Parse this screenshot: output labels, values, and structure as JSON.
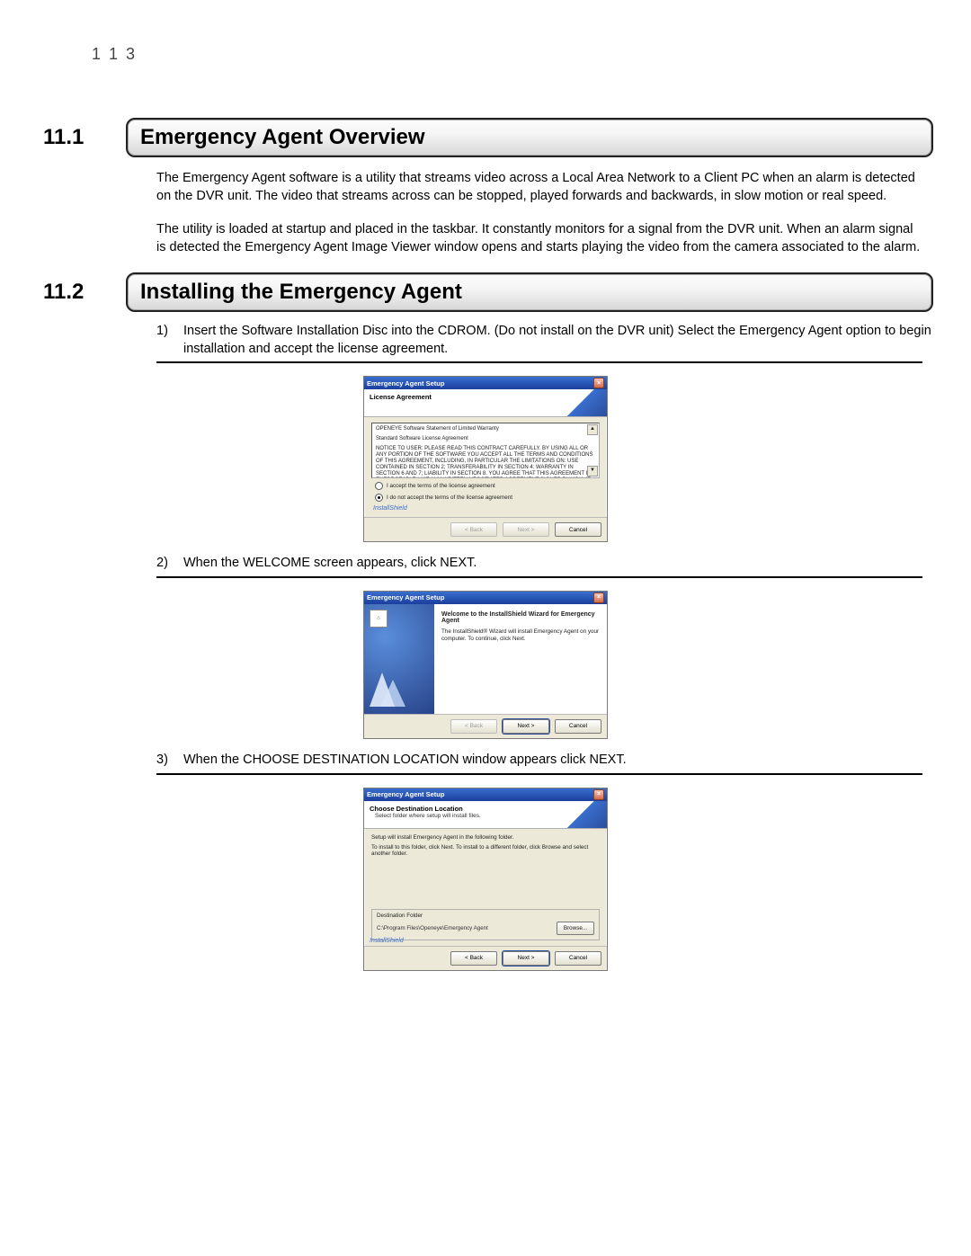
{
  "page_number": "1 1 3",
  "sections": [
    {
      "num": "11.1",
      "title": "Emergency Agent Overview"
    },
    {
      "num": "11.2",
      "title": "Installing the Emergency Agent"
    }
  ],
  "overview": {
    "p1": "The Emergency Agent software is a utility that streams video across a Local Area Network to a Client PC when an alarm is detected on the DVR unit. The video that streams across can be stopped, played forwards and backwards, in slow motion or real speed.",
    "p2": "The utility is loaded at startup and placed in the taskbar. It constantly monitors for a signal from the DVR unit. When an alarm signal is detected the Emergency Agent Image Viewer window opens and starts playing the video from the camera associated to the alarm."
  },
  "steps": [
    {
      "n": "1)",
      "t": "Insert the Software Installation Disc into the CDROM. (Do not install on the DVR unit) Select the Emergency Agent option to begin installation and accept the license agreement."
    },
    {
      "n": "2)",
      "t": "When the WELCOME screen appears, click NEXT."
    },
    {
      "n": "3)",
      "t": "When the CHOOSE DESTINATION LOCATION window appears click NEXT."
    }
  ],
  "dialog_common": {
    "title": "Emergency Agent Setup",
    "brand": "InstallShield",
    "back": "< Back",
    "next": "Next >",
    "cancel": "Cancel",
    "browse": "Browse..."
  },
  "dialog1": {
    "header": "License Agreement",
    "box_line1": "OPENEYE Software Statement of Limited Warranty",
    "box_line2": "Standard Software License Agreement",
    "box_body": "NOTICE TO USER: PLEASE READ THIS CONTRACT CAREFULLY. BY USING ALL OR ANY PORTION OF THE SOFTWARE YOU ACCEPT ALL THE TERMS AND CONDITIONS OF THIS AGREEMENT, INCLUDING, IN PARTICULAR THE LIMITATIONS ON: USE CONTAINED IN SECTION 2; TRANSFERABILITY IN SECTION 4; WARRANTY IN SECTION 6 AND 7; LIABILITY IN SECTION 8. YOU AGREE THAT THIS AGREEMENT IS ENFORCEABLE LIKE ANY WRITTEN NEGOTIATED AGREEMENT SIGNED BY YOU. IF YOU DO NOT AGREE, DO NOT USE THIS",
    "radio_accept": "I accept the terms of the license agreement",
    "radio_decline": "I do not accept the terms of the license agreement"
  },
  "dialog2": {
    "wtitle": "Welcome to the InstallShield Wizard for Emergency Agent",
    "wtext": "The InstallShield® Wizard will install Emergency Agent on your computer. To continue, click Next."
  },
  "dialog3": {
    "header": "Choose Destination Location",
    "sub": "Select folder where setup will install files.",
    "line1": "Setup will install Emergency Agent in the following folder.",
    "line2": "To install to this folder, click Next. To install to a different folder, click Browse and select another folder.",
    "group_label": "Destination Folder",
    "path": "C:\\Program Files\\Openeye\\Emergency Agent"
  }
}
